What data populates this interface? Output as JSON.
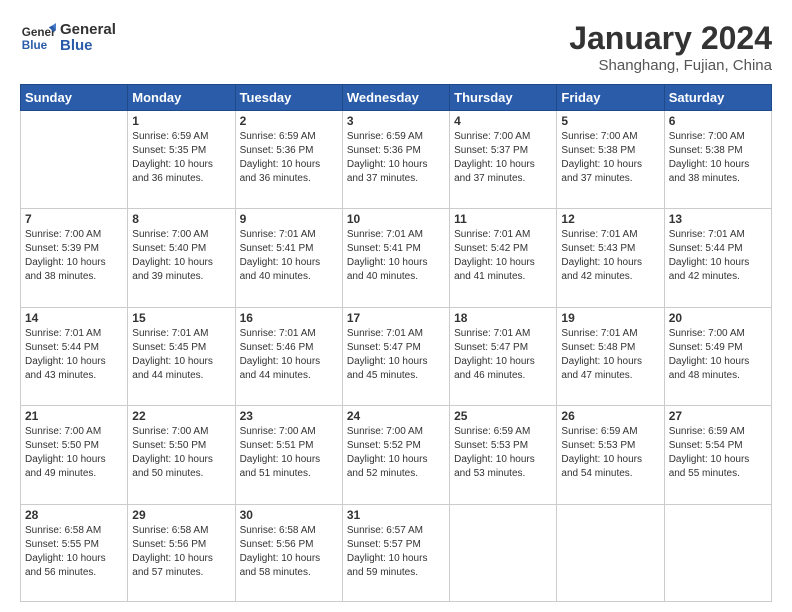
{
  "header": {
    "logo_general": "General",
    "logo_blue": "Blue",
    "month": "January 2024",
    "location": "Shanghang, Fujian, China"
  },
  "weekdays": [
    "Sunday",
    "Monday",
    "Tuesday",
    "Wednesday",
    "Thursday",
    "Friday",
    "Saturday"
  ],
  "weeks": [
    [
      {
        "day": "",
        "info": ""
      },
      {
        "day": "1",
        "info": "Sunrise: 6:59 AM\nSunset: 5:35 PM\nDaylight: 10 hours\nand 36 minutes."
      },
      {
        "day": "2",
        "info": "Sunrise: 6:59 AM\nSunset: 5:36 PM\nDaylight: 10 hours\nand 36 minutes."
      },
      {
        "day": "3",
        "info": "Sunrise: 6:59 AM\nSunset: 5:36 PM\nDaylight: 10 hours\nand 37 minutes."
      },
      {
        "day": "4",
        "info": "Sunrise: 7:00 AM\nSunset: 5:37 PM\nDaylight: 10 hours\nand 37 minutes."
      },
      {
        "day": "5",
        "info": "Sunrise: 7:00 AM\nSunset: 5:38 PM\nDaylight: 10 hours\nand 37 minutes."
      },
      {
        "day": "6",
        "info": "Sunrise: 7:00 AM\nSunset: 5:38 PM\nDaylight: 10 hours\nand 38 minutes."
      }
    ],
    [
      {
        "day": "7",
        "info": "Sunrise: 7:00 AM\nSunset: 5:39 PM\nDaylight: 10 hours\nand 38 minutes."
      },
      {
        "day": "8",
        "info": "Sunrise: 7:00 AM\nSunset: 5:40 PM\nDaylight: 10 hours\nand 39 minutes."
      },
      {
        "day": "9",
        "info": "Sunrise: 7:01 AM\nSunset: 5:41 PM\nDaylight: 10 hours\nand 40 minutes."
      },
      {
        "day": "10",
        "info": "Sunrise: 7:01 AM\nSunset: 5:41 PM\nDaylight: 10 hours\nand 40 minutes."
      },
      {
        "day": "11",
        "info": "Sunrise: 7:01 AM\nSunset: 5:42 PM\nDaylight: 10 hours\nand 41 minutes."
      },
      {
        "day": "12",
        "info": "Sunrise: 7:01 AM\nSunset: 5:43 PM\nDaylight: 10 hours\nand 42 minutes."
      },
      {
        "day": "13",
        "info": "Sunrise: 7:01 AM\nSunset: 5:44 PM\nDaylight: 10 hours\nand 42 minutes."
      }
    ],
    [
      {
        "day": "14",
        "info": "Sunrise: 7:01 AM\nSunset: 5:44 PM\nDaylight: 10 hours\nand 43 minutes."
      },
      {
        "day": "15",
        "info": "Sunrise: 7:01 AM\nSunset: 5:45 PM\nDaylight: 10 hours\nand 44 minutes."
      },
      {
        "day": "16",
        "info": "Sunrise: 7:01 AM\nSunset: 5:46 PM\nDaylight: 10 hours\nand 44 minutes."
      },
      {
        "day": "17",
        "info": "Sunrise: 7:01 AM\nSunset: 5:47 PM\nDaylight: 10 hours\nand 45 minutes."
      },
      {
        "day": "18",
        "info": "Sunrise: 7:01 AM\nSunset: 5:47 PM\nDaylight: 10 hours\nand 46 minutes."
      },
      {
        "day": "19",
        "info": "Sunrise: 7:01 AM\nSunset: 5:48 PM\nDaylight: 10 hours\nand 47 minutes."
      },
      {
        "day": "20",
        "info": "Sunrise: 7:00 AM\nSunset: 5:49 PM\nDaylight: 10 hours\nand 48 minutes."
      }
    ],
    [
      {
        "day": "21",
        "info": "Sunrise: 7:00 AM\nSunset: 5:50 PM\nDaylight: 10 hours\nand 49 minutes."
      },
      {
        "day": "22",
        "info": "Sunrise: 7:00 AM\nSunset: 5:50 PM\nDaylight: 10 hours\nand 50 minutes."
      },
      {
        "day": "23",
        "info": "Sunrise: 7:00 AM\nSunset: 5:51 PM\nDaylight: 10 hours\nand 51 minutes."
      },
      {
        "day": "24",
        "info": "Sunrise: 7:00 AM\nSunset: 5:52 PM\nDaylight: 10 hours\nand 52 minutes."
      },
      {
        "day": "25",
        "info": "Sunrise: 6:59 AM\nSunset: 5:53 PM\nDaylight: 10 hours\nand 53 minutes."
      },
      {
        "day": "26",
        "info": "Sunrise: 6:59 AM\nSunset: 5:53 PM\nDaylight: 10 hours\nand 54 minutes."
      },
      {
        "day": "27",
        "info": "Sunrise: 6:59 AM\nSunset: 5:54 PM\nDaylight: 10 hours\nand 55 minutes."
      }
    ],
    [
      {
        "day": "28",
        "info": "Sunrise: 6:58 AM\nSunset: 5:55 PM\nDaylight: 10 hours\nand 56 minutes."
      },
      {
        "day": "29",
        "info": "Sunrise: 6:58 AM\nSunset: 5:56 PM\nDaylight: 10 hours\nand 57 minutes."
      },
      {
        "day": "30",
        "info": "Sunrise: 6:58 AM\nSunset: 5:56 PM\nDaylight: 10 hours\nand 58 minutes."
      },
      {
        "day": "31",
        "info": "Sunrise: 6:57 AM\nSunset: 5:57 PM\nDaylight: 10 hours\nand 59 minutes."
      },
      {
        "day": "",
        "info": ""
      },
      {
        "day": "",
        "info": ""
      },
      {
        "day": "",
        "info": ""
      }
    ]
  ]
}
